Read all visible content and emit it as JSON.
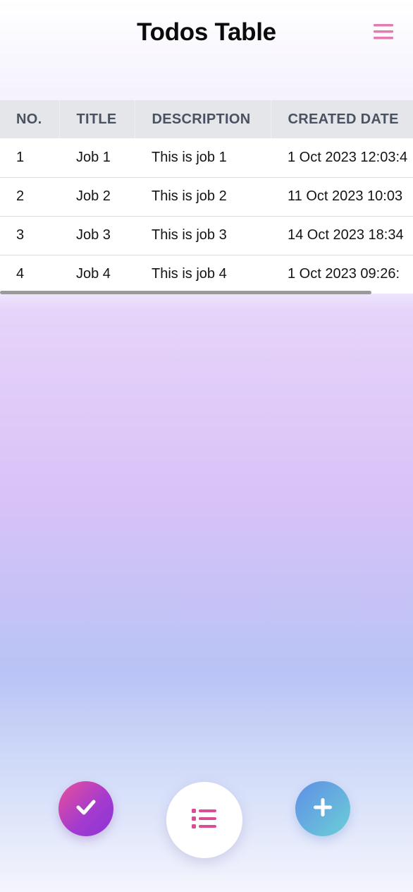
{
  "header": {
    "title": "Todos Table",
    "menu_icon": "hamburger-menu-icon",
    "menu_color": "#e27db4"
  },
  "table": {
    "columns": [
      "NO.",
      "TITLE",
      "DESCRIPTION",
      "CREATED DATE"
    ],
    "rows": [
      {
        "no": "1",
        "title": "Job 1",
        "description": "This is job 1",
        "created": "1 Oct 2023 12:03:4"
      },
      {
        "no": "2",
        "title": "Job 2",
        "description": "This is job 2",
        "created": "11 Oct 2023 10:03"
      },
      {
        "no": "3",
        "title": "Job 3",
        "description": "This is job 3",
        "created": "14 Oct 2023 18:34"
      },
      {
        "no": "4",
        "title": "Job 4",
        "description": "This is job 4",
        "created": "1 Oct 2023 09:26:"
      }
    ]
  },
  "bottom_nav": {
    "complete_icon": "check-icon",
    "list_icon": "list-icon",
    "add_icon": "plus-icon",
    "list_icon_color": "#d94d95"
  },
  "colors": {
    "header_text": "#0b0b0b",
    "table_header_bg": "#e4e6ea",
    "table_header_text": "#4a5160"
  }
}
